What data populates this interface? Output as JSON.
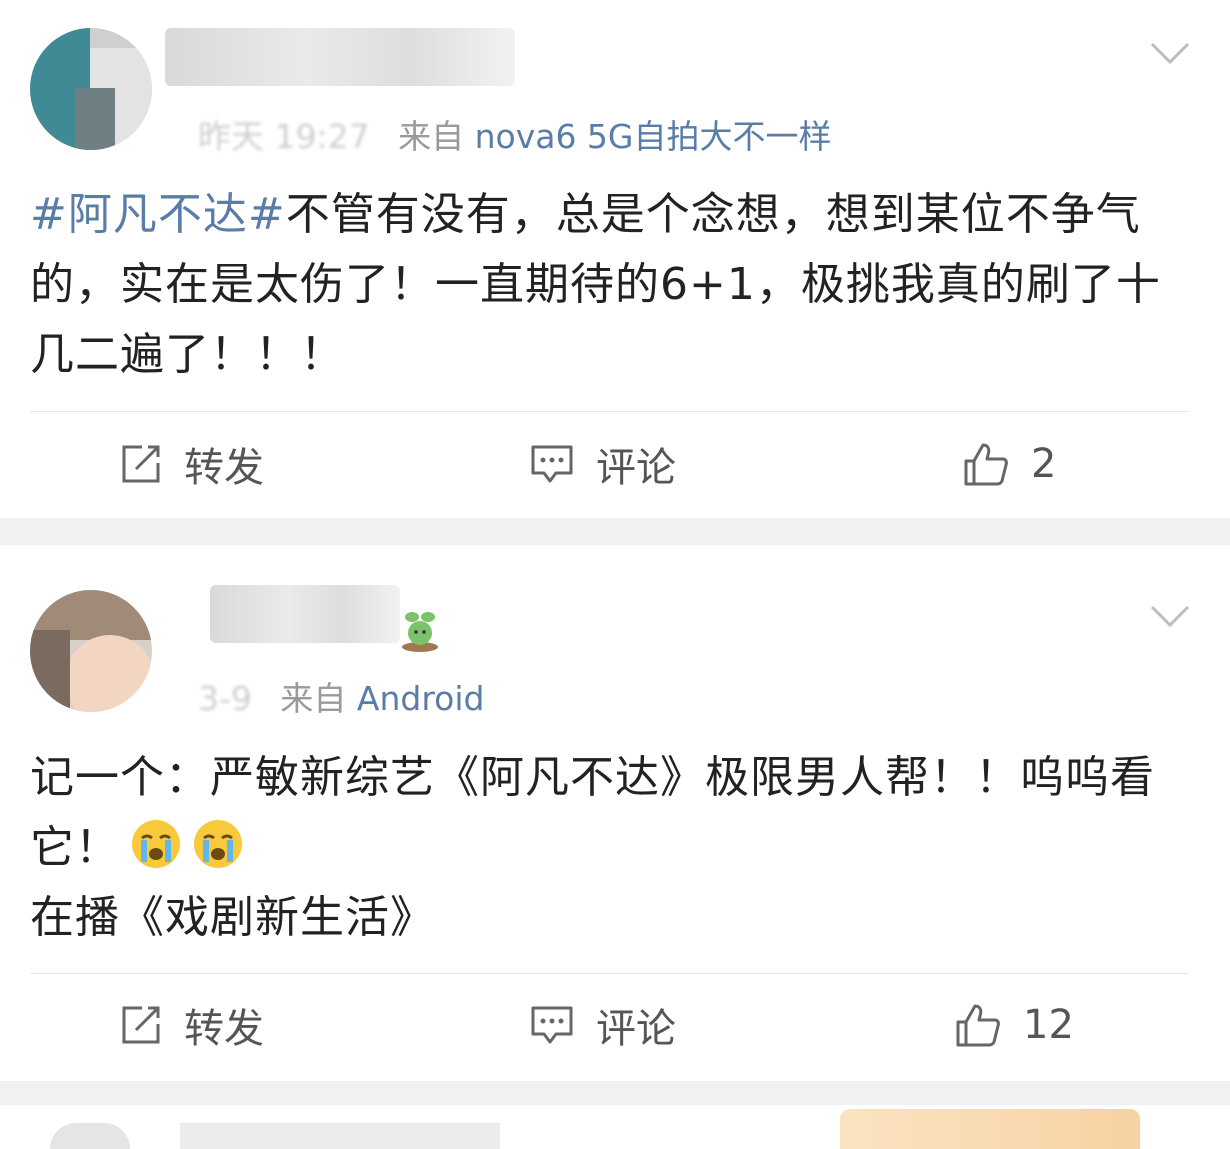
{
  "posts": [
    {
      "time": "昨天 19:27",
      "source_prefix": "来自",
      "source": "nova6 5G自拍大不一样",
      "hashtag": "#阿凡不达#",
      "text": "不管有没有，总是个念想，想到某位不争气的，实在是太伤了！一直期待的6+1，极挑我真的刷了十几二遍了！！！",
      "actions": {
        "repost": "转发",
        "comment": "评论",
        "like_count": "2"
      }
    },
    {
      "time": "3-9",
      "source_prefix": "来自",
      "source": "Android",
      "text_line1": "记一个：严敏新综艺《阿凡不达》极限男人帮！！呜呜看它！",
      "text_line2": "在播《戏剧新生活》",
      "emojis": [
        "crying-emoji",
        "crying-emoji"
      ],
      "actions": {
        "repost": "转发",
        "comment": "评论",
        "like_count": "12"
      }
    }
  ],
  "colors": {
    "link": "#5a7da8",
    "text": "#222222",
    "meta": "#9a9a9a",
    "bg": "#f1f1f1"
  }
}
